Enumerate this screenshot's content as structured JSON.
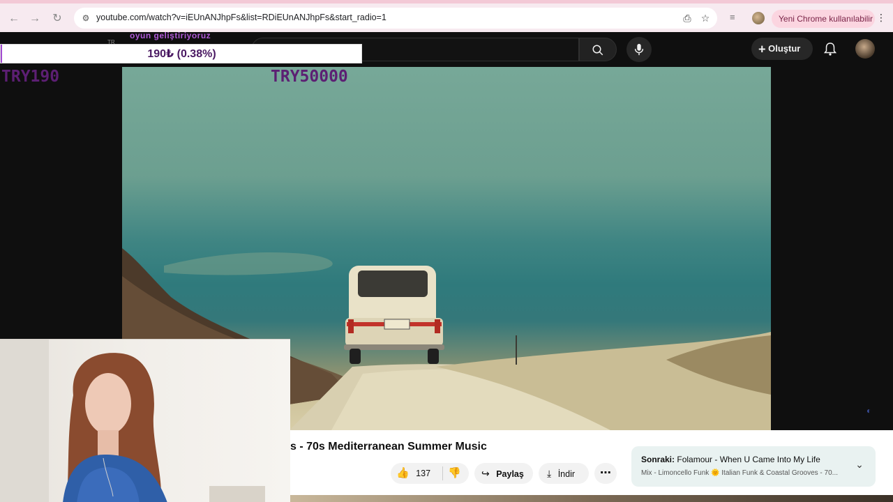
{
  "browser": {
    "url": "youtube.com/watch?v=iEUnANJhpFs&list=RDiEUnANJhpFs&start_radio=1",
    "update_label": "Yeni Chrome kullanılabilir"
  },
  "youtube": {
    "create_label": "Oluştur",
    "video_title": "s - 70s Mediterranean Summer Music",
    "likes": "137",
    "share_label": "Paylaş",
    "download_label": "İndir",
    "next": {
      "prefix": "Sonraki:",
      "title": "Folamour - When U Came Into My Life",
      "playlist": "Mix - Limoncello Funk 🌞 Italian Funk & Coastal Grooves - 70..."
    }
  },
  "overlay": {
    "top_text": "oyun geliştiriyoruz",
    "tr_tag": "TR",
    "donation_text": "190₺ (0.38%)",
    "donation_progress_percent": 0.38,
    "current_amount": "TRY190",
    "goal_amount": "TRY50000",
    "accent": "#a24ad1"
  }
}
